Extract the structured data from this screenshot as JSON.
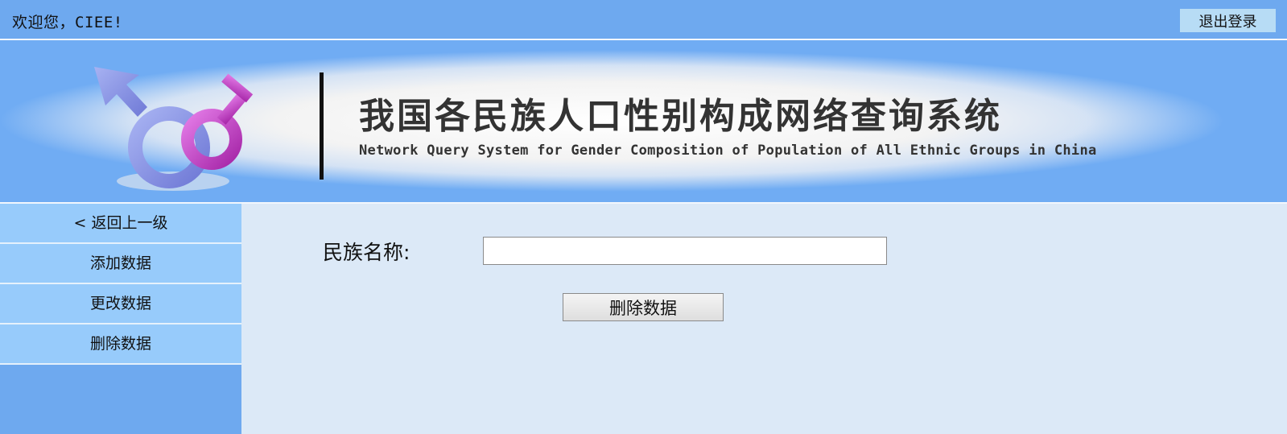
{
  "header": {
    "welcome": "欢迎您，CIEE!",
    "logout_label": "退出登录"
  },
  "banner": {
    "title_cn": "我国各民族人口性别构成网络查询系统",
    "title_en": "Network Query System for Gender Composition of Population of All Ethnic Groups in China",
    "logo_icon": "gender-symbols-logo-icon"
  },
  "sidebar": {
    "items": [
      {
        "label": "<  返回上一级"
      },
      {
        "label": "添加数据"
      },
      {
        "label": "更改数据"
      },
      {
        "label": "删除数据"
      }
    ]
  },
  "form": {
    "field_label": "民族名称:",
    "field_value": "",
    "submit_label": "删除数据"
  },
  "colors": {
    "top_bar": "#6ea9ef",
    "sidebar_item": "#97cbfb",
    "content_bg": "#dce9f7",
    "male_symbol": "#8a95e6",
    "female_symbol": "#c040c0"
  }
}
